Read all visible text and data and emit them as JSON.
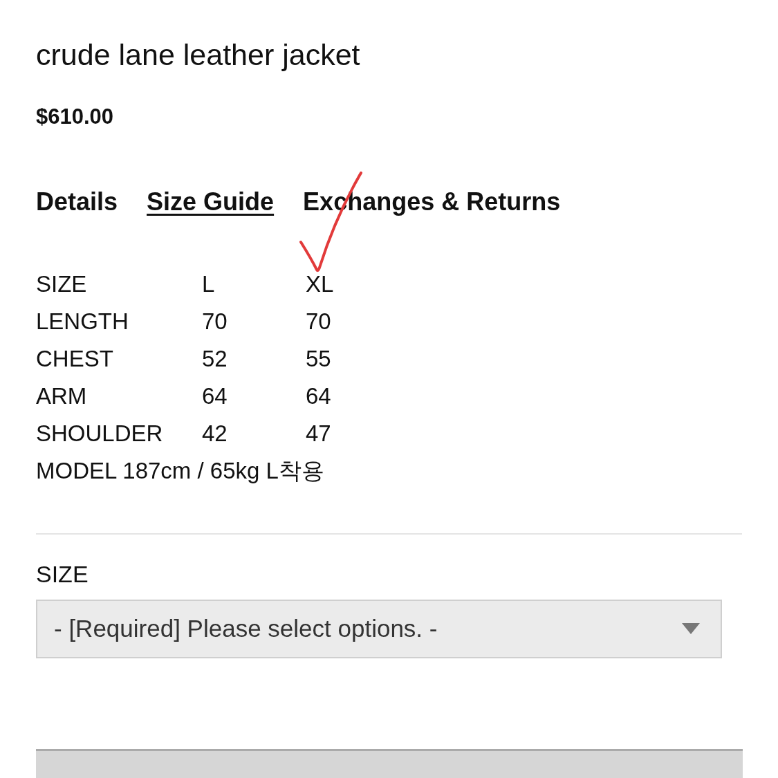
{
  "product": {
    "title": "crude lane leather jacket",
    "price": "$610.00"
  },
  "tabs": [
    {
      "label": "Details",
      "selected": false
    },
    {
      "label": "Size Guide",
      "selected": true
    },
    {
      "label": "Exchanges & Returns",
      "selected": false
    }
  ],
  "size_table": {
    "rows": [
      [
        "SIZE",
        "L",
        "XL"
      ],
      [
        "LENGTH",
        "70",
        "70"
      ],
      [
        "CHEST",
        "52",
        "55"
      ],
      [
        "ARM",
        "64",
        "64"
      ],
      [
        "SHOULDER",
        "42",
        "47"
      ]
    ],
    "note": "MODEL 187cm / 65kg L착용"
  },
  "option": {
    "label": "SIZE",
    "value": "- [Required] Please select options. -"
  }
}
